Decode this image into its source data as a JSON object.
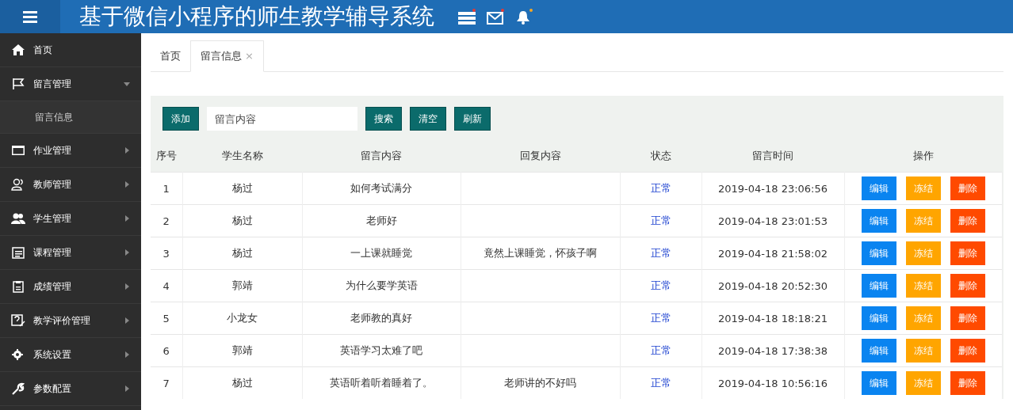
{
  "header": {
    "title": "基于微信小程序的师生教学辅导系统"
  },
  "sidebar": {
    "items": [
      {
        "label": "首页"
      },
      {
        "label": "留言管理",
        "expanded": true,
        "children": [
          {
            "label": "留言信息",
            "selected": true
          }
        ]
      },
      {
        "label": "作业管理",
        "expanded": false
      },
      {
        "label": "教师管理",
        "expanded": false
      },
      {
        "label": "学生管理",
        "expanded": false
      },
      {
        "label": "课程管理",
        "expanded": false
      },
      {
        "label": "成绩管理",
        "expanded": false
      },
      {
        "label": "教学评价管理",
        "expanded": false
      },
      {
        "label": "系统设置",
        "expanded": false
      },
      {
        "label": "参数配置",
        "expanded": false
      }
    ]
  },
  "tabs": [
    {
      "label": "首页",
      "selected": false
    },
    {
      "label": "留言信息",
      "selected": true,
      "close": "×"
    }
  ],
  "toolbar": {
    "add": "添加",
    "search": {
      "placeholder": "留言内容"
    },
    "buttons": [
      "搜索",
      "清空",
      "刷新"
    ]
  },
  "table": {
    "columns": [
      "序号",
      "学生名称",
      "留言内容",
      "回复内容",
      "状态",
      "留言时间",
      "操作"
    ],
    "rows": [
      {
        "no": "1",
        "student": "杨过",
        "message": "如何考试满分",
        "reply": "",
        "status": "正常",
        "time": "2019-04-18 23:06:56",
        "actions": [
          "编辑",
          "冻结",
          "删除"
        ]
      },
      {
        "no": "2",
        "student": "杨过",
        "message": "老师好",
        "reply": "",
        "status": "正常",
        "time": "2019-04-18 23:01:53",
        "actions": [
          "编辑",
          "冻结",
          "删除"
        ]
      },
      {
        "no": "3",
        "student": "杨过",
        "message": "一上课就睡觉",
        "reply": "竟然上课睡觉，怀孩子啊",
        "status": "正常",
        "time": "2019-04-18 21:58:02",
        "actions": [
          "编辑",
          "冻结",
          "删除"
        ]
      },
      {
        "no": "4",
        "student": "郭靖",
        "message": "为什么要学英语",
        "reply": "",
        "status": "正常",
        "time": "2019-04-18 20:52:30",
        "actions": [
          "编辑",
          "冻结",
          "删除"
        ]
      },
      {
        "no": "5",
        "student": "小龙女",
        "message": "老师教的真好",
        "reply": "",
        "status": "正常",
        "time": "2019-04-18 18:18:21",
        "actions": [
          "编辑",
          "冻结",
          "删除"
        ]
      },
      {
        "no": "6",
        "student": "郭靖",
        "message": "英语学习太难了吧",
        "reply": "",
        "status": "正常",
        "time": "2019-04-18 17:38:38",
        "actions": [
          "编辑",
          "冻结",
          "删除"
        ]
      },
      {
        "no": "7",
        "student": "杨过",
        "message": "英语听着听着睡着了。",
        "reply": "老师讲的不好吗",
        "status": "正常",
        "time": "2019-04-18 10:56:16",
        "actions": [
          "编辑",
          "冻结",
          "删除"
        ]
      }
    ]
  }
}
